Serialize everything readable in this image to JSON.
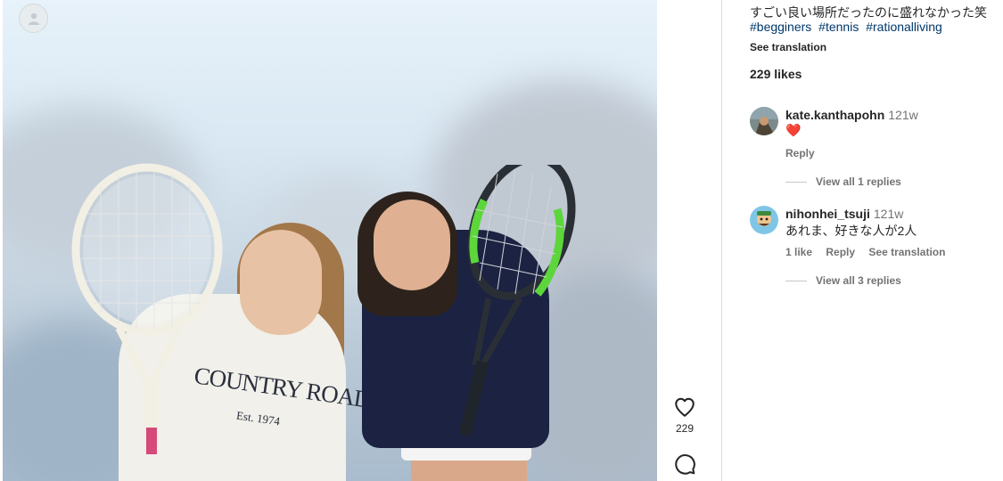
{
  "post": {
    "caption": "すごい良い場所だったのに盛れなかった笑",
    "hashtags": [
      "#begginers",
      "#tennis",
      "#rationalliving"
    ],
    "see_translation": "See translation",
    "likes_text": "229 likes",
    "like_count": "229",
    "photo_shirt_text": "COUNTRY ROAD",
    "photo_shirt_subtext": "Est. 1974"
  },
  "comments": [
    {
      "username": "kate.kanthapohn",
      "time": "121w",
      "text": "❤️",
      "actions": [
        "Reply"
      ],
      "view_replies": "View all 1 replies"
    },
    {
      "username": "nihonhei_tsuji",
      "time": "121w",
      "text": "あれま、好きな人が2人",
      "actions": [
        "1 like",
        "Reply",
        "See translation"
      ],
      "view_replies": "View all 3 replies"
    }
  ],
  "icons": {
    "tag_user": "user-icon",
    "like": "heart-icon",
    "comment": "comment-icon"
  },
  "colors": {
    "hashtag": "#00376b",
    "secondary_text": "#737373",
    "primary_text": "#262626"
  }
}
